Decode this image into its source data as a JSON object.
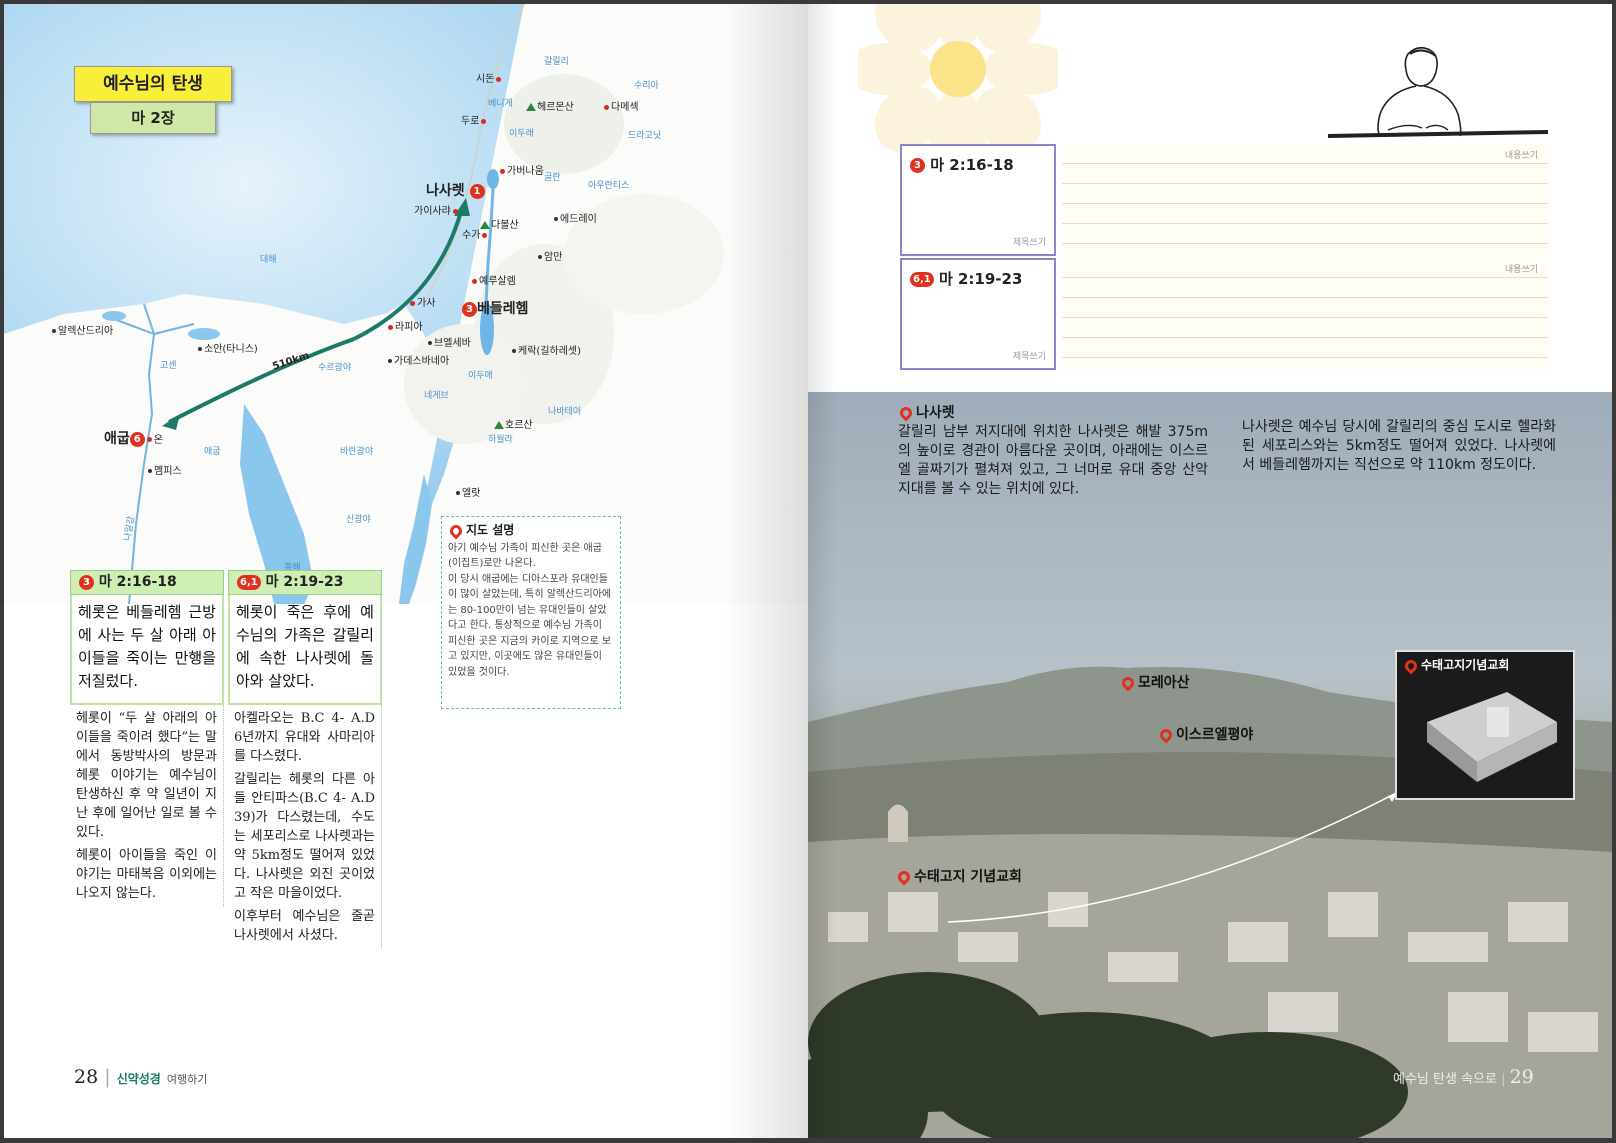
{
  "left_page": {
    "title": "예수님의 탄생",
    "subtitle": "마 2장",
    "map": {
      "places": {
        "sidon": "시돈",
        "tyre": "두로",
        "damascus": "다메섹",
        "hermon": "헤르몬산",
        "capernaum": "가버나움",
        "nazareth": "나사렛",
        "caesarea": "가이사랴",
        "tabor": "다볼산",
        "sychar": "수가",
        "edrei": "에드레이",
        "amman": "암만",
        "jerusalem": "예루살렘",
        "bethlehem": "베들레헴",
        "gaza": "가사",
        "rafia": "라피아",
        "beersheba": "브엘세바",
        "kerak": "케락(길하레셋)",
        "kadesh": "가데스바네아",
        "alexandria": "알렉산드리아",
        "tanis": "소안(타니스)",
        "egypt": "애굽",
        "on": "온",
        "memphis": "멤피스",
        "hor": "호르산",
        "elath": "엘랏",
        "dist": "510km"
      },
      "regions": [
        "갈릴리",
        "수리아",
        "베니게",
        "이두래",
        "드라고닛",
        "골란",
        "아우란티스",
        "대해",
        "고센",
        "수르광야",
        "네게브",
        "이두매",
        "나바테아",
        "바란광야",
        "애굽",
        "신광야",
        "홍해",
        "하월라",
        "나일강"
      ]
    },
    "map_desc": {
      "heading": "지도 설명",
      "p1": "아기 예수님 가족이 피신한 곳은 애굽(이집트)로만 나온다.",
      "p2": "이 당시 애굽에는 디아스포라 유대인들이 많이 살았는데, 특히 알렉산드리아에는 80-100만이 넘는 유대인들이 살았다고 한다. 통상적으로 예수님 가족이 피신한 곳은 지금의 카이로 지역으로 보고 있지만, 이곳에도 많은 유대인들이 있었을 것이다."
    },
    "verses": [
      {
        "badge": "3",
        "ref": "마 2:16-18",
        "text": "헤롯은 베들레헴 근방에 사는 두 살 아래 아이들을 죽이는 만행을 저질렀다.",
        "note1": "헤롯이 “두 살 아래의 아이들을 죽이려 했다”는 말에서 동방박사의 방문과 헤롯 이야기는 예수님이 탄생하신 후 약 일년이 지난 후에 일어난 일로 볼 수 있다.",
        "note2": "헤롯이 아이들을 죽인 이야기는 마태복음 이외에는 나오지 않는다."
      },
      {
        "badge": "6,1",
        "ref": "마 2:19-23",
        "text": "헤롯이 죽은 후에 예수님의 가족은 갈릴리에 속한 나사렛에 돌아와 살았다.",
        "note1": "아켈라오는 B.C 4- A.D 6년까지 유대와 사마리아를 다스렸다.",
        "note2": "갈릴리는 헤롯의 다른 아들 안티파스(B.C 4- A.D 39)가 다스렸는데, 수도는 세포리스로 나사렛과는 약 5km정도 떨어져 있었다. 나사렛은 외진 곳이었고 작은 마을이었다.",
        "note3": "이후부터 예수님은 줄곧 나사렛에서 사셨다."
      }
    ],
    "footer": {
      "page": "28",
      "book": "신약성경",
      "suffix": "여행하기"
    }
  },
  "right_page": {
    "notes": [
      {
        "badge": "3",
        "ref": "마 2:16-18",
        "sig": "제목쓰기",
        "tag": "내용쓰기"
      },
      {
        "badge": "6,1",
        "ref": "마 2:19-23",
        "sig": "제목쓰기",
        "tag": "내용쓰기"
      }
    ],
    "nazareth_heading": "나사렛",
    "nazareth_text": "갈릴리 남부 저지대에 위치한 나사렛은 해발 375m의 높이로 경관이 아름다운 곳이며, 아래에는 이스르엘 골짜기가 펼쳐져 있고, 그 너머로 유대 중앙 산악지대를 볼 수 있는 위치에 있다.",
    "nazareth_text2": "나사렛은 예수님 당시에 갈릴리의 중심 도시로 헬라화된 세포리스와는 5km정도 떨어져 있었다. 나사렛에서 베들레헴까지는 직선으로 약 110km 정도이다.",
    "labels": {
      "moreh": "모레아산",
      "jezreel": "이스르엘평야",
      "church_inset": "수태고지기념교회",
      "church": "수태고지 기념교회"
    },
    "footer": {
      "text": "예수님 탄생 속으로",
      "page": "29"
    }
  },
  "colors": {
    "title_yellow": "#f7ef3a",
    "title_green": "#cfe8a5",
    "route_arrow": "#1e7a68",
    "marker_red": "#e0311f",
    "note_border": "#8a84c8"
  }
}
